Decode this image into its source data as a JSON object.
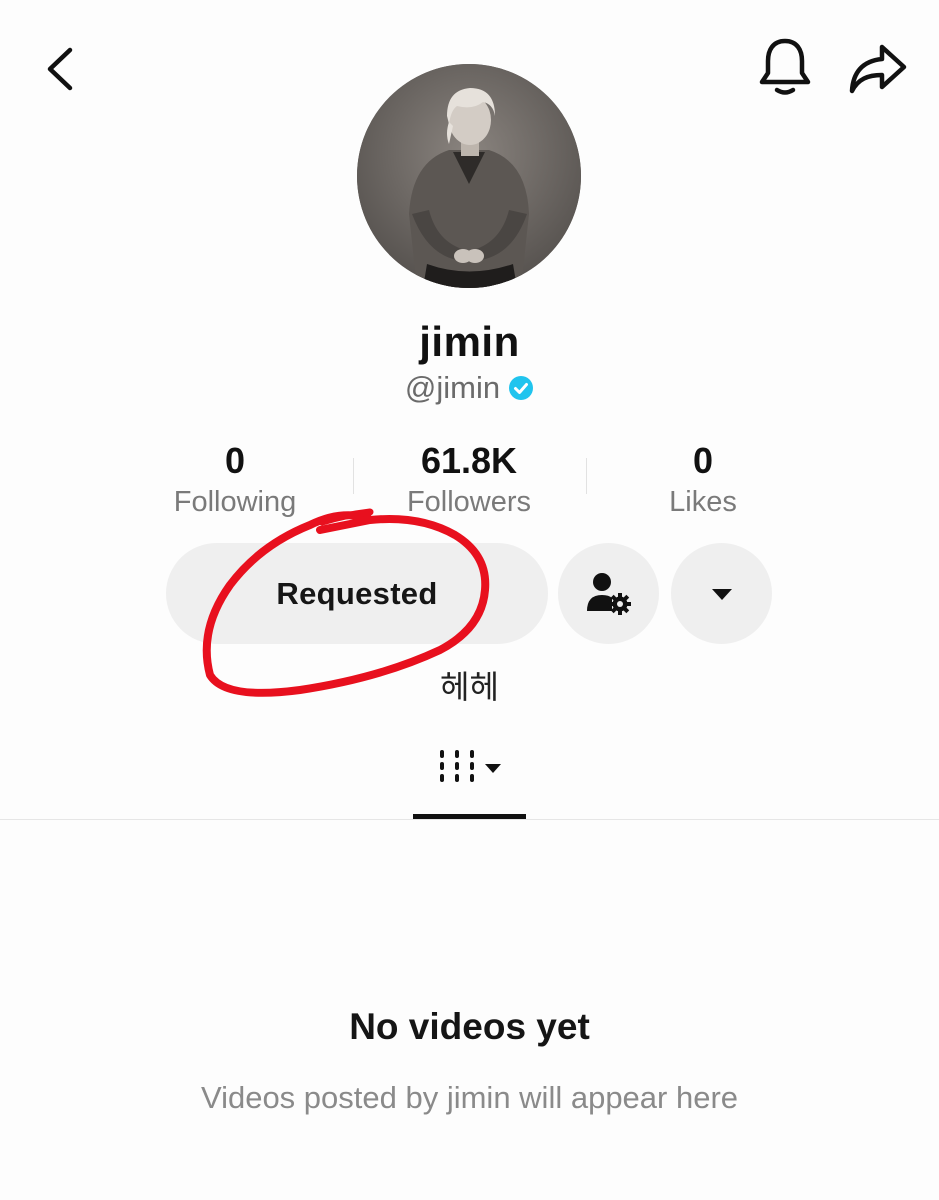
{
  "profile": {
    "display_name": "jimin",
    "handle": "@jimin",
    "verified_icon": "verified-badge-icon",
    "bio": "헤헤"
  },
  "stats": [
    {
      "value": "0",
      "label": "Following"
    },
    {
      "value": "61.8K",
      "label": "Followers"
    },
    {
      "value": "0",
      "label": "Likes"
    }
  ],
  "actions": {
    "requested_label": "Requested",
    "friend_settings_icon": "person-gear-icon",
    "more_icon": "caret-down-icon"
  },
  "topbar": {
    "back_icon": "chevron-left-icon",
    "notification_icon": "bell-icon",
    "share_icon": "share-arrow-icon"
  },
  "tabs": {
    "active_icon": "grid-menu-icon"
  },
  "empty_state": {
    "title": "No videos yet",
    "subtitle": "Videos posted by jimin will appear here"
  },
  "colors": {
    "verified": "#20c4ee",
    "button_bg": "#efefef",
    "annotation": "#e8101e"
  }
}
